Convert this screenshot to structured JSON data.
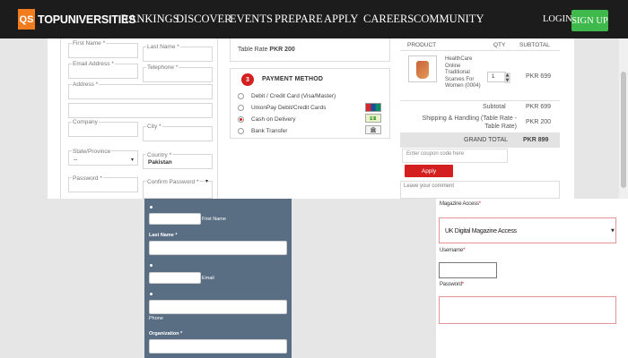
{
  "nav": {
    "logo_badge": "QS",
    "logo_text": "TOPUNIVERSITIES",
    "items": [
      "RANKINGS",
      "DISCOVER",
      "EVENTS",
      "PREPARE",
      "APPLY",
      "CAREERS",
      "COMMUNITY"
    ],
    "login": "LOGIN",
    "signup": "SIGN UP"
  },
  "billing": {
    "first_name_label": "First Name *",
    "last_name_label": "Last Name *",
    "email_label": "Email Address *",
    "telephone_label": "Telephone *",
    "address_label": "Address *",
    "company_label": "Company",
    "city_label": "City *",
    "state_label": "State/Province",
    "state_value": "--",
    "country_label": "Country *",
    "country_value": "Pakistan",
    "password_label": "Password *",
    "confirm_password_label": "Confirm Password *"
  },
  "shipping": {
    "table_rate_label": "Table Rate",
    "table_rate_value": "PKR 200"
  },
  "payment": {
    "step": "3",
    "title": "PAYMENT METHOD",
    "options": [
      {
        "label": "Debit / Credit Card (Visa/Master)",
        "selected": false,
        "icon": ""
      },
      {
        "label": "UnionPay Debit/Credit Cards",
        "selected": false,
        "icon": "unionpay-icon"
      },
      {
        "label": "Cash on Delivery",
        "selected": true,
        "icon": "cash-icon"
      },
      {
        "label": "Bank Transfer",
        "selected": false,
        "icon": "bank-icon"
      }
    ]
  },
  "order": {
    "col_product": "PRODUCT",
    "col_qty": "QTY",
    "col_subtotal": "SUBTOTAL",
    "product_name": "HealthCare Online Traditional Scarves For Women (0004)",
    "qty": "1",
    "price": "PKR 699",
    "subtotal_label": "Subtotal",
    "subtotal_value": "PKR 699",
    "shipping_label": "Shipping & Handling (Table Rate - Table Rate)",
    "shipping_value": "PKR 200",
    "grand_total_label": "GRAND TOTAL",
    "grand_total_value": "PKR 899"
  },
  "coupon": {
    "placeholder": "Enter coupon code here",
    "apply": "Apply"
  },
  "comment": {
    "placeholder": "Leave your comment"
  },
  "signup_form": {
    "first_name_label": "First Name",
    "last_name_label": "Last Name *",
    "email_label": "Email",
    "phone_label": "Phone",
    "organization_label": "Organization *"
  },
  "magazine_form": {
    "access_label": "Magazine Access",
    "access_value": "UK Digital Magazine Access",
    "username_label": "Username",
    "password_label": "Password",
    "required_mark": "*"
  }
}
